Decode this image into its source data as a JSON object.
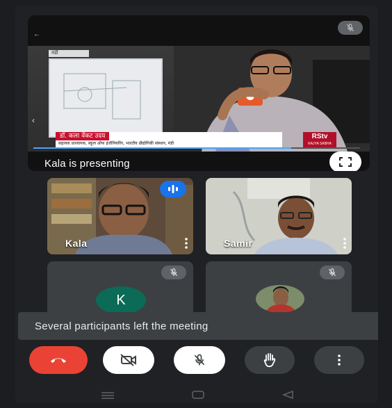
{
  "presentation": {
    "label": "Kala is presenting",
    "channel_tag": "मंडी",
    "lower_third_name": "डॉ. कला वेंकट उदय",
    "lower_third_subtitle": "सहायक प्राध्यापक, स्कूल ऑफ इंजीनियरिंग, भारतीय प्रौद्योगिकी संस्थान, मंडी",
    "channel_logo": "RStv",
    "channel_logo_sub": "RAJYA SABHA",
    "playback_progress": 0.79
  },
  "participants": [
    {
      "name": "Kala",
      "speaking": true
    },
    {
      "name": "Samir",
      "speaking": false
    },
    {
      "initial": "K",
      "muted": true
    },
    {
      "photo": true,
      "muted": true
    }
  ],
  "toast": {
    "text": "Several participants left the meeting"
  },
  "colors": {
    "background": "#202124",
    "end_call": "#ea4335",
    "speaking": "#1a73e8",
    "avatar_k": "#0b6b57"
  },
  "icons": [
    "mic-off-icon",
    "fullscreen-icon",
    "end-call-icon",
    "camera-off-icon",
    "raise-hand-icon",
    "more-vert-icon",
    "speaking-indicator-icon"
  ]
}
